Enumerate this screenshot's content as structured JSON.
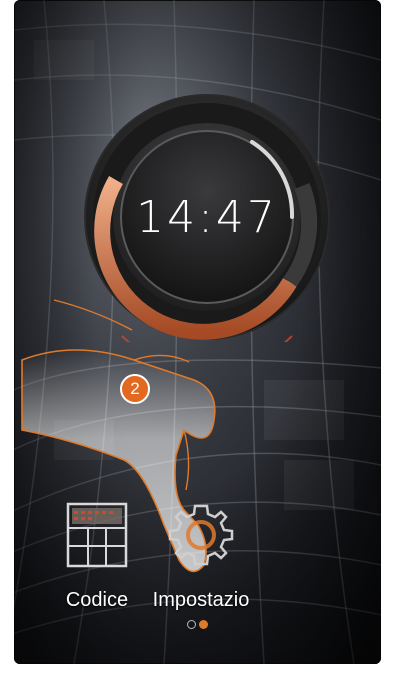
{
  "clock": {
    "time": "14:47"
  },
  "apps": [
    {
      "label": "Codice",
      "icon": "keypad-icon"
    },
    {
      "label": "Impostazio",
      "icon": "gear-icon"
    }
  ],
  "pager": {
    "pages": 2,
    "current": 2
  },
  "annotation": {
    "step": "2"
  },
  "colors": {
    "accent": "#e07a2b",
    "badge": "#e2691f"
  }
}
